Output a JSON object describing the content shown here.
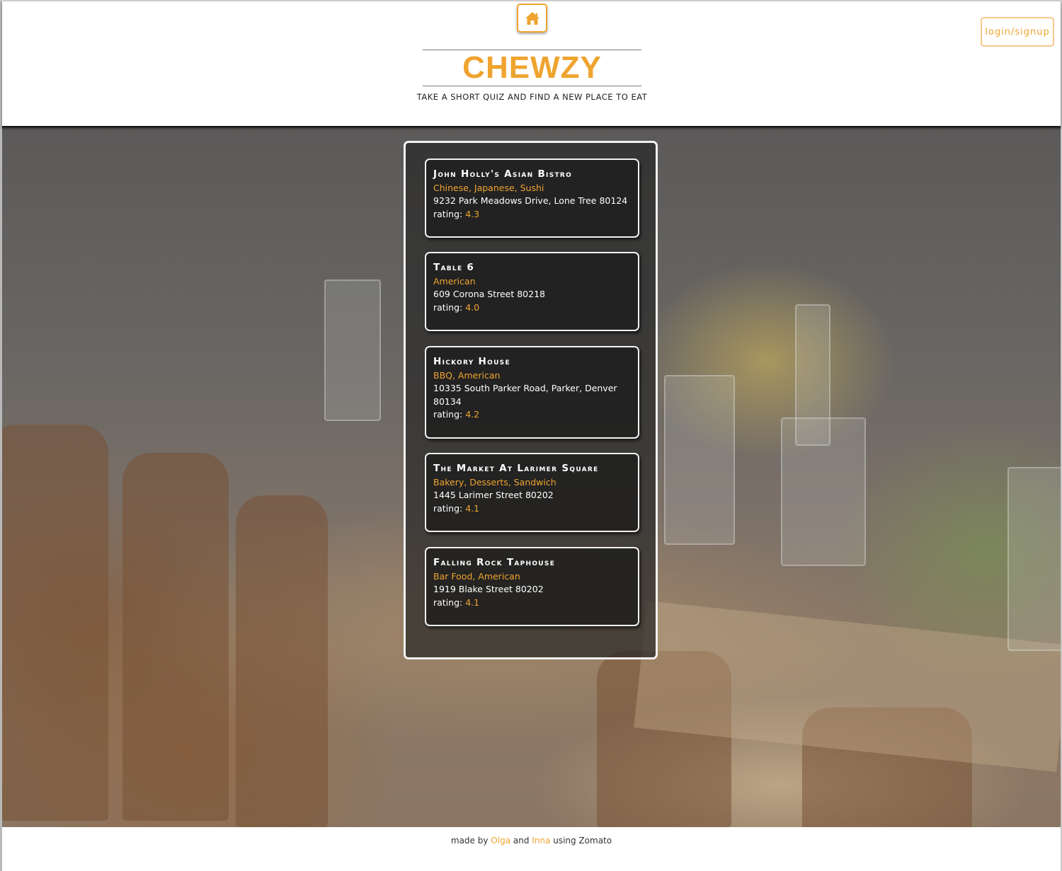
{
  "header": {
    "title": "CHEWZY",
    "tagline": "TAKE A SHORT QUIZ AND FIND A NEW PLACE TO EAT",
    "home_icon": "home-icon",
    "login_label": "login/signup"
  },
  "results": [
    {
      "name": "John Holly's Asian Bistro",
      "cuisines": "Chinese, Japanese, Sushi",
      "address": "9232 Park Meadows Drive, Lone Tree 80124",
      "rating_label": "rating:",
      "rating": "4.3"
    },
    {
      "name": "Table 6",
      "cuisines": "American",
      "address": "609 Corona Street 80218",
      "rating_label": "rating:",
      "rating": "4.0"
    },
    {
      "name": "Hickory House",
      "cuisines": "BBQ, American",
      "address": "10335 South Parker Road, Parker, Denver 80134",
      "rating_label": "rating:",
      "rating": "4.2"
    },
    {
      "name": "The Market At Larimer Square",
      "cuisines": "Bakery, Desserts, Sandwich",
      "address": "1445 Larimer Street 80202",
      "rating_label": "rating:",
      "rating": "4.1"
    },
    {
      "name": "Falling Rock Taphouse",
      "cuisines": "Bar Food, American",
      "address": "1919 Blake Street 80202",
      "rating_label": "rating:",
      "rating": "4.1"
    }
  ],
  "footer": {
    "prefix": "made by",
    "author1": "Olga",
    "conjunction": "and",
    "author2": "Inna",
    "suffix": "using Zomato"
  },
  "colors": {
    "accent": "#efa42f",
    "card_bg": "#1c1c1c",
    "header_bg": "#ffffff"
  }
}
